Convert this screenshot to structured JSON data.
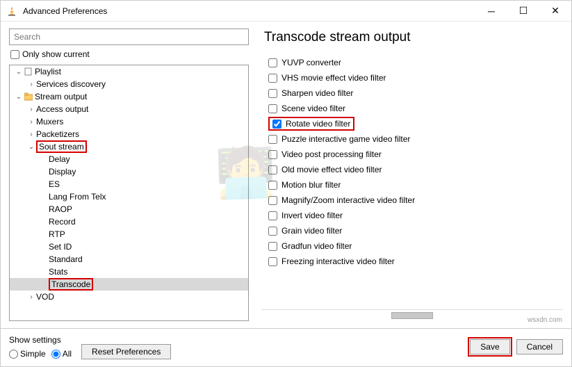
{
  "window": {
    "title": "Advanced Preferences"
  },
  "search": {
    "placeholder": "Search"
  },
  "only_current": {
    "label": "Only show current"
  },
  "tree": {
    "items": [
      {
        "label": "Playlist",
        "indent": 1,
        "twist": "v",
        "icon": "page"
      },
      {
        "label": "Services discovery",
        "indent": 2,
        "twist": ">",
        "icon": "none"
      },
      {
        "label": "Stream output",
        "indent": 1,
        "twist": "v",
        "icon": "folder"
      },
      {
        "label": "Access output",
        "indent": 2,
        "twist": ">",
        "icon": "none"
      },
      {
        "label": "Muxers",
        "indent": 2,
        "twist": ">",
        "icon": "none"
      },
      {
        "label": "Packetizers",
        "indent": 2,
        "twist": ">",
        "icon": "none"
      },
      {
        "label": "Sout stream",
        "indent": 2,
        "twist": "v",
        "icon": "none",
        "hi": true
      },
      {
        "label": "Delay",
        "indent": 3,
        "twist": "",
        "icon": "none"
      },
      {
        "label": "Display",
        "indent": 3,
        "twist": "",
        "icon": "none"
      },
      {
        "label": "ES",
        "indent": 3,
        "twist": "",
        "icon": "none"
      },
      {
        "label": "Lang From Telx",
        "indent": 3,
        "twist": "",
        "icon": "none"
      },
      {
        "label": "RAOP",
        "indent": 3,
        "twist": "",
        "icon": "none"
      },
      {
        "label": "Record",
        "indent": 3,
        "twist": "",
        "icon": "none"
      },
      {
        "label": "RTP",
        "indent": 3,
        "twist": "",
        "icon": "none"
      },
      {
        "label": "Set ID",
        "indent": 3,
        "twist": "",
        "icon": "none"
      },
      {
        "label": "Standard",
        "indent": 3,
        "twist": "",
        "icon": "none"
      },
      {
        "label": "Stats",
        "indent": 3,
        "twist": "",
        "icon": "none"
      },
      {
        "label": "Transcode",
        "indent": 3,
        "twist": "",
        "icon": "none",
        "sel": true,
        "hi": true
      },
      {
        "label": "VOD",
        "indent": 2,
        "twist": ">",
        "icon": "none"
      }
    ]
  },
  "panel": {
    "title": "Transcode stream output",
    "filters": [
      {
        "label": "YUVP converter",
        "checked": false
      },
      {
        "label": "VHS movie effect video filter",
        "checked": false
      },
      {
        "label": "Sharpen video filter",
        "checked": false
      },
      {
        "label": "Scene video filter",
        "checked": false
      },
      {
        "label": "Rotate video filter",
        "checked": true,
        "hi": true
      },
      {
        "label": "Puzzle interactive game video filter",
        "checked": false
      },
      {
        "label": "Video post processing filter",
        "checked": false
      },
      {
        "label": "Old movie effect video filter",
        "checked": false
      },
      {
        "label": "Motion blur filter",
        "checked": false
      },
      {
        "label": "Magnify/Zoom interactive video filter",
        "checked": false
      },
      {
        "label": "Invert video filter",
        "checked": false
      },
      {
        "label": "Grain video filter",
        "checked": false
      },
      {
        "label": "Gradfun video filter",
        "checked": false
      },
      {
        "label": "Freezing interactive video filter",
        "checked": false
      }
    ]
  },
  "footer": {
    "show_label": "Show settings",
    "simple": "Simple",
    "all": "All",
    "reset": "Reset Preferences",
    "save": "Save",
    "cancel": "Cancel"
  },
  "source_watermark": "wsxdn.com"
}
